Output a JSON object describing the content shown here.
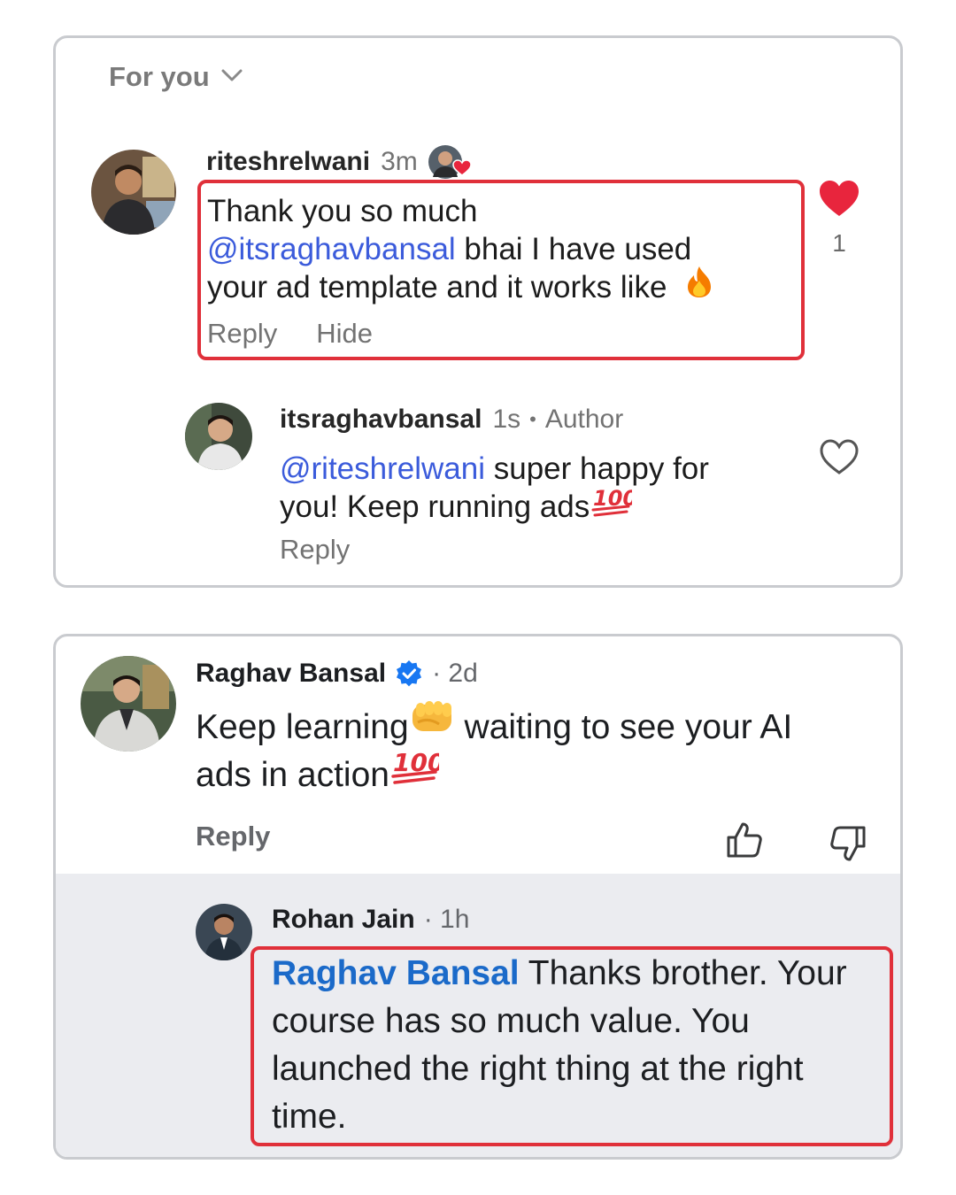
{
  "feed": {
    "filter_label": "For you"
  },
  "ig_comment": {
    "username": "riteshrelwani",
    "time": "3m",
    "line1": "Thank you so much",
    "mention": "@itsraghavbansal",
    "line2_rest": " bhai I have used",
    "line3": "your ad template and it works like",
    "emoji_end": "fire",
    "reply_label": "Reply",
    "hide_label": "Hide",
    "like_count": "1"
  },
  "ig_reply": {
    "username": "itsraghavbansal",
    "time": "1s",
    "separator": "•",
    "author_badge": "Author",
    "mention": "@riteshrelwani",
    "line1_rest": " super happy for",
    "line2": "you! Keep running ads",
    "emoji_end": "hundred-points",
    "reply_label": "Reply"
  },
  "fb_comment": {
    "name": "Raghav Bansal",
    "time": "· 2d",
    "line1_a": "Keep learning",
    "line1_b": " waiting to see your AI",
    "line2": "ads in action",
    "reply_label": "Reply"
  },
  "fb_reply": {
    "name": "Rohan Jain",
    "time": "· 1h",
    "mention": "Raghav Bansal",
    "line1_rest": " Thanks brother. Your",
    "line2": "course has so much value. You",
    "line3": "launched the right thing at the right",
    "line4": "time."
  },
  "colors": {
    "highlight_box": "#e0303a",
    "like_heart": "#e8253d",
    "ig_mention": "#3b5bdb",
    "fb_mention": "#1b6ac9",
    "verified": "#1877f2"
  }
}
